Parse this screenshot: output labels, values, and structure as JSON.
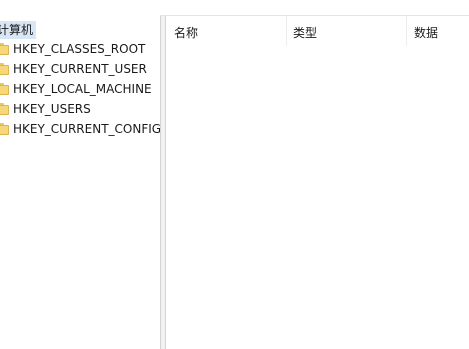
{
  "tree": {
    "root_label": "计算机",
    "items": [
      {
        "label": "HKEY_CLASSES_ROOT",
        "icon": "folder-icon"
      },
      {
        "label": "HKEY_CURRENT_USER",
        "icon": "folder-icon"
      },
      {
        "label": "HKEY_LOCAL_MACHINE",
        "icon": "folder-icon"
      },
      {
        "label": "HKEY_USERS",
        "icon": "folder-icon"
      },
      {
        "label": "HKEY_CURRENT_CONFIG",
        "icon": "folder-icon"
      }
    ]
  },
  "list": {
    "columns": [
      {
        "label": "名称"
      },
      {
        "label": "类型"
      },
      {
        "label": "数据"
      }
    ]
  },
  "colors": {
    "selection": "#d9e6f5",
    "folder": "#f6d77a"
  }
}
